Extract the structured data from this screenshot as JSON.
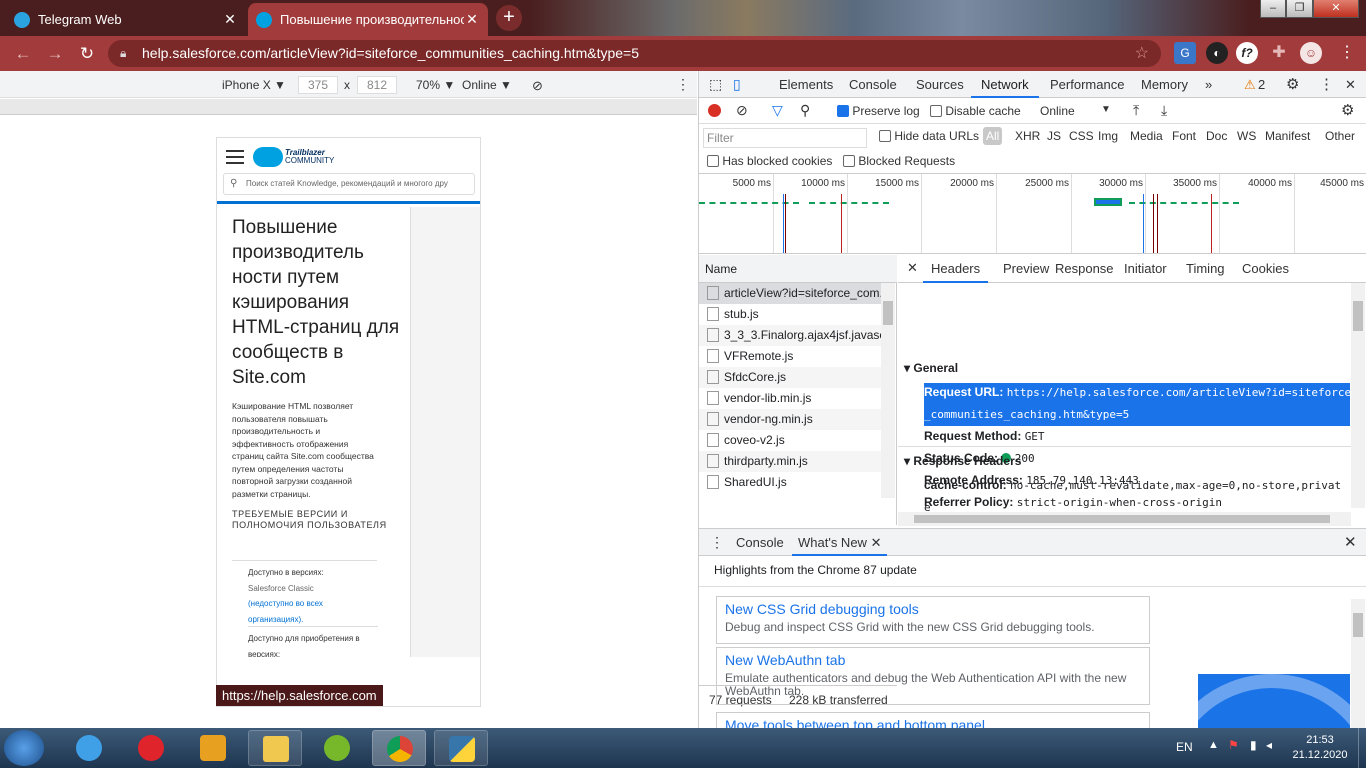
{
  "browser": {
    "tabs": [
      {
        "title": "Telegram Web",
        "icon_color": "#2aa3e0"
      },
      {
        "title": "Повышение производительнос",
        "icon_color": "#00a1e0"
      }
    ],
    "new_tab": "+",
    "url": "help.salesforce.com/articleView?id=siteforce_communities_caching.htm&type=5",
    "window_buttons": {
      "minimize": "‒",
      "maximize": "❐",
      "close": "✕"
    }
  },
  "device_toolbar": {
    "device": "iPhone X ▼",
    "width": "375",
    "times": "x",
    "height": "812",
    "zoom": "70% ▼",
    "throttle": "Online ▼"
  },
  "page": {
    "brand_top": "Trailblazer",
    "brand_bottom": "COMMUNITY",
    "search_placeholder": "Поиск статей Knowledge, рекомендаций и многого дру",
    "title": "Повышение производитель ности путем кэширования HTML-страниц для сообществ в Site.com",
    "description": "Кэширование HTML позволяет пользователя повышать производительность и эффективность отображения страниц сайта Site.com сообщества путем определения частоты повторной загрузки созданной разметки страницы.",
    "requirements": "ТРЕБУЕМЫЕ ВЕРСИИ И ПОЛНОМОЧИЯ ПОЛЬЗОВАТЕЛЯ",
    "available_label": "Доступно в версиях:",
    "available_edition": "Salesforce Classic",
    "available_link": "(недоступно во всех организациях).",
    "available_purchase": "Доступно для приобретения в версиях:",
    "status_url": "https://help.salesforce.com"
  },
  "devtools": {
    "tabs": [
      "Elements",
      "Console",
      "Sources",
      "Network",
      "Performance",
      "Memory",
      "»"
    ],
    "active_tab": "Network",
    "warnings": "2",
    "preserve_log": "Preserve log",
    "disable_cache": "Disable cache",
    "throttle": "Online",
    "filter_placeholder": "Filter",
    "hide_data_urls": "Hide data URLs",
    "filter_types": [
      "All",
      "XHR",
      "JS",
      "CSS",
      "Img",
      "Media",
      "Font",
      "Doc",
      "WS",
      "Manifest",
      "Other"
    ],
    "has_blocked_cookies": "Has blocked cookies",
    "blocked_requests": "Blocked Requests",
    "timeline_ticks": [
      "5000 ms",
      "10000 ms",
      "15000 ms",
      "20000 ms",
      "25000 ms",
      "30000 ms",
      "35000 ms",
      "40000 ms",
      "45000 ms"
    ],
    "name_header": "Name",
    "requests": [
      "articleView?id=siteforce_com...",
      "stub.js",
      "3_3_3.Finalorg.ajax4jsf.javascri",
      "VFRemote.js",
      "SfdcCore.js",
      "vendor-lib.min.js",
      "vendor-ng.min.js",
      "coveo-v2.js",
      "thirdparty.min.js",
      "SharedUI.js"
    ],
    "request_count": "77 requests",
    "transferred": "228 kB transferred",
    "detail_tabs": [
      "Headers",
      "Preview",
      "Response",
      "Initiator",
      "Timing",
      "Cookies"
    ],
    "general_label": "General",
    "request_url_key": "Request URL:",
    "request_url_val1": "https://help.salesforce.com/articleView?id=siteforce",
    "request_url_val2": "_communities_caching.htm&type=5",
    "request_method_key": "Request Method:",
    "request_method_val": "GET",
    "status_code_key": "Status Code:",
    "status_code_val": "200",
    "remote_address_key": "Remote Address:",
    "remote_address_val": "185.79.140.13:443",
    "referrer_key": "Referrer Policy:",
    "referrer_val": "strict-origin-when-cross-origin",
    "response_headers_label": "Response Headers",
    "cache_control_key": "cache-control:",
    "cache_control_val": "no-cache,must-revalidate,max-age=0,no-store,privat",
    "cache_control_wrap": "e"
  },
  "drawer": {
    "tabs": [
      "Console",
      "What's New"
    ],
    "highlights": "Highlights from the Chrome 87 update",
    "cards": [
      {
        "title": "New CSS Grid debugging tools",
        "desc": "Debug and inspect CSS Grid with the new CSS Grid debugging tools."
      },
      {
        "title": "New WebAuthn tab",
        "desc": "Emulate authenticators and debug the Web Authentication API with the new WebAuthn tab."
      },
      {
        "title": "Move tools between top and bottom panel",
        "desc": ""
      }
    ]
  },
  "taskbar": {
    "lang": "EN",
    "time": "21:53",
    "date": "21.12.2020"
  }
}
